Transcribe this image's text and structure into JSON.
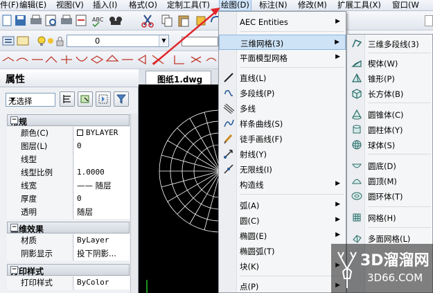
{
  "menubar": {
    "items": [
      "件(F)",
      "编辑(E)",
      "视图(V)",
      "插入(I)",
      "格式(O)",
      "定制工具(T)",
      "绘图(D)",
      "标注(N)",
      "修改(M)",
      "扩展工具(X)",
      "窗口(W"
    ],
    "active": "绘图(D)"
  },
  "toolbar": {
    "layer_value": "0"
  },
  "properties": {
    "title": "属性",
    "selection": "无选择",
    "sections": {
      "general": {
        "title": "常规",
        "rows": [
          {
            "k": "颜色(C)",
            "v": "BYLAYER"
          },
          {
            "k": "图层(L)",
            "v": "0"
          },
          {
            "k": "线型",
            "v": ""
          },
          {
            "k": "线型比例",
            "v": "1.0000"
          },
          {
            "k": "线宽",
            "v": "—— 随层"
          },
          {
            "k": "厚度",
            "v": "0"
          },
          {
            "k": "透明",
            "v": "随层"
          }
        ]
      },
      "effects3d": {
        "title": "三维效果",
        "rows": [
          {
            "k": "材质",
            "v": "ByLayer"
          },
          {
            "k": "阴影显示",
            "v": "投下阴影..."
          }
        ]
      },
      "print": {
        "title": "打印样式",
        "rows": [
          {
            "k": "打印样式",
            "v": "ByColor"
          }
        ]
      }
    }
  },
  "document": {
    "tab": "图纸1.dwg"
  },
  "draw_menu": {
    "items": [
      {
        "label": "AEC Entities",
        "sub": true,
        "icon": ""
      },
      {
        "label": "三维网格(3)",
        "sub": true,
        "icon": "",
        "hl": true
      },
      {
        "label": "平面模型网格",
        "sub": true,
        "icon": ""
      },
      {
        "label": "直线(L)",
        "sub": false,
        "icon": "line-icon"
      },
      {
        "label": "多段线(P)",
        "sub": false,
        "icon": "polyline-icon"
      },
      {
        "label": "多线",
        "sub": false,
        "icon": "multiline-icon"
      },
      {
        "label": "样条曲线(S)",
        "sub": false,
        "icon": "spline-icon"
      },
      {
        "label": "徒手画线(F)",
        "sub": false,
        "icon": "freehand-icon"
      },
      {
        "label": "射线(Y)",
        "sub": false,
        "icon": "ray-icon"
      },
      {
        "label": "无限线(I)",
        "sub": false,
        "icon": "xline-icon"
      },
      {
        "label": "构造线",
        "sub": true,
        "icon": ""
      },
      {
        "label": "弧(A)",
        "sub": true,
        "icon": ""
      },
      {
        "label": "圆(C)",
        "sub": true,
        "icon": ""
      },
      {
        "label": "椭圆(E)",
        "sub": true,
        "icon": ""
      },
      {
        "label": "椭圆弧(T)",
        "sub": false,
        "icon": ""
      },
      {
        "label": "块(K)",
        "sub": true,
        "icon": ""
      },
      {
        "label": "点(P)",
        "sub": true,
        "icon": ""
      }
    ]
  },
  "mesh_menu": {
    "items": [
      {
        "label": "三维多段线(3)",
        "icon": "3d-polyline-icon"
      },
      {
        "label": "楔体(W)",
        "icon": "wedge-icon"
      },
      {
        "label": "锥形(P)",
        "icon": "pyramid-icon"
      },
      {
        "label": "长方体(B)",
        "icon": "box-icon"
      },
      {
        "label": "圆锥体(C)",
        "icon": "cone-icon"
      },
      {
        "label": "圆柱体(Y)",
        "icon": "cylinder-icon"
      },
      {
        "label": "球体(S)",
        "icon": "sphere-icon"
      },
      {
        "label": "圆底(D)",
        "icon": "dish-icon"
      },
      {
        "label": "圆顶(M)",
        "icon": "dome-icon"
      },
      {
        "label": "圆环体(T)",
        "icon": "torus-icon"
      },
      {
        "label": "网格(H)",
        "icon": "mesh-icon"
      },
      {
        "label": "多面网格(L)",
        "icon": "polyface-icon"
      }
    ]
  },
  "watermark": {
    "line1": "3D溜溜网",
    "line2": "3D66.COM"
  },
  "colors": {
    "accent_arrow": "#e0262b",
    "highlight": "#cfe3f7"
  }
}
